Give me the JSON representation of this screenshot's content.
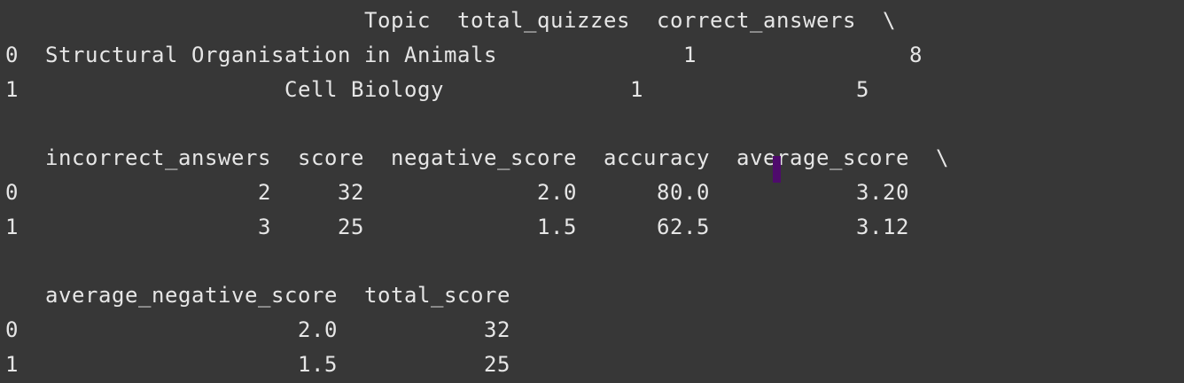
{
  "output_lines": [
    "                           Topic  total_quizzes  correct_answers  \\",
    "0  Structural Organisation in Animals              1                8",
    "1                    Cell Biology              1                5",
    "",
    "   incorrect_answers  score  negative_score  accuracy  average_score  \\",
    "0                  2     32             2.0      80.0           3.20",
    "1                  3     25             1.5      62.5           3.12",
    "",
    "   average_negative_score  total_score",
    "0                     2.0           32",
    "1                     1.5           25"
  ],
  "colors": {
    "background": "#373737",
    "text": "#e6e6e6",
    "cursor": "#4e0b6c"
  }
}
